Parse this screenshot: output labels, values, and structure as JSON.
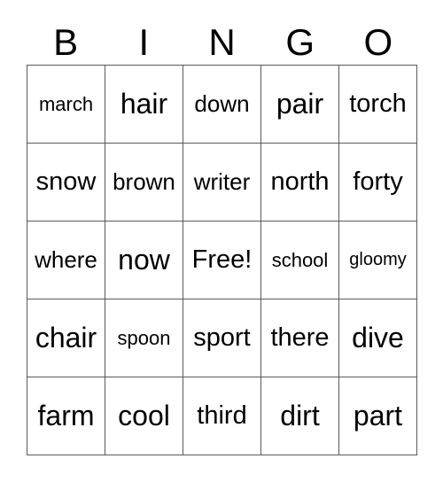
{
  "card": {
    "header_letters": [
      "B",
      "I",
      "N",
      "G",
      "O"
    ],
    "free_space_label": "Free!",
    "border_color": "#5a5a5a",
    "background_color": "#ffffff",
    "text_color": "#000000",
    "rows": [
      [
        {
          "label": "march",
          "size": "s"
        },
        {
          "label": "hair",
          "size": "xl"
        },
        {
          "label": "down",
          "size": "m"
        },
        {
          "label": "pair",
          "size": "xl"
        },
        {
          "label": "torch",
          "size": "l"
        }
      ],
      [
        {
          "label": "snow",
          "size": "l"
        },
        {
          "label": "brown",
          "size": "m"
        },
        {
          "label": "writer",
          "size": "m"
        },
        {
          "label": "north",
          "size": "l"
        },
        {
          "label": "forty",
          "size": "l"
        }
      ],
      [
        {
          "label": "where",
          "size": "m"
        },
        {
          "label": "now",
          "size": "xl"
        },
        {
          "label": "Free!",
          "size": "l"
        },
        {
          "label": "school",
          "size": "s"
        },
        {
          "label": "gloomy",
          "size": "xs"
        }
      ],
      [
        {
          "label": "chair",
          "size": "xl"
        },
        {
          "label": "spoon",
          "size": "s"
        },
        {
          "label": "sport",
          "size": "l"
        },
        {
          "label": "there",
          "size": "l"
        },
        {
          "label": "dive",
          "size": "xl"
        }
      ],
      [
        {
          "label": "farm",
          "size": "xl"
        },
        {
          "label": "cool",
          "size": "xl"
        },
        {
          "label": "third",
          "size": "l"
        },
        {
          "label": "dirt",
          "size": "xl"
        },
        {
          "label": "part",
          "size": "xl"
        }
      ]
    ]
  }
}
